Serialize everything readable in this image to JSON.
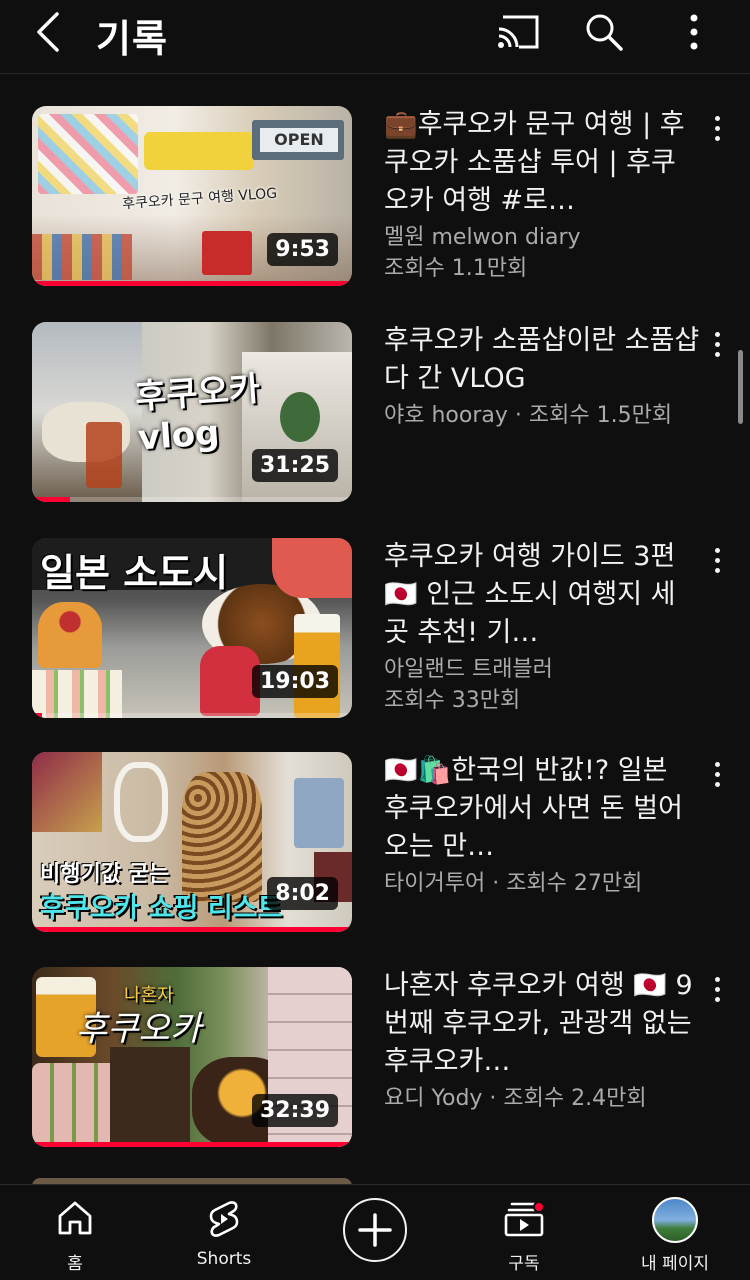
{
  "header": {
    "title": "기록"
  },
  "colors": {
    "background": "#0f0f0f",
    "accent": "#ff0033",
    "meta_text": "#aaaaaa"
  },
  "videos": [
    {
      "title": "💼후쿠오카 문구 여행 | 후쿠오카 소품샵 투어 | 후쿠오카 여행 #로…",
      "channel": "멜원 melwon diary",
      "views": "조회수 1.1만회",
      "duration": "9:53",
      "overlay": "후쿠오카 문구 여행 VLOG",
      "progress": 1.0
    },
    {
      "title": "후쿠오카 소품샵이란 소품샵 다 간 VLOG",
      "channel": "야호 hooray",
      "views": "조회수 1.5만회",
      "duration": "31:25",
      "overlay": "후쿠오카 vlog",
      "progress": 0.12
    },
    {
      "title": "후쿠오카 여행 가이드 3편 🇯🇵 인근 소도시 여행지 세곳 추천! 기…",
      "channel": "아일랜드 트래블러",
      "views": "조회수 33만회",
      "duration": "19:03",
      "overlay": "일본 소도시",
      "progress": 0.03
    },
    {
      "title": "🇯🇵🛍️한국의 반값!? 일본 후쿠오카에서 사면 돈 벌어오는 만…",
      "channel": "타이거투어",
      "views": "조회수 27만회",
      "duration": "8:02",
      "overlay_top": "비행기값 굳는",
      "overlay_bottom": "후쿠오카 쇼핑 리스트",
      "progress": 1.0
    },
    {
      "title": "나혼자 후쿠오카 여행 🇯🇵 9번째 후쿠오카, 관광객 없는 후쿠오카…",
      "channel": "요디 Yody",
      "views": "조회수 2.4만회",
      "duration": "32:39",
      "overlay_small": "나혼자",
      "overlay": "후쿠오카",
      "progress": 1.0
    }
  ],
  "bottom_nav": {
    "home": "홈",
    "shorts": "Shorts",
    "subscriptions": "구독",
    "you": "내 페이지"
  },
  "icons": [
    "back-icon",
    "cast-icon",
    "search-icon",
    "more-vert-icon",
    "home-icon",
    "shorts-icon",
    "add-icon",
    "subscriptions-icon"
  ]
}
